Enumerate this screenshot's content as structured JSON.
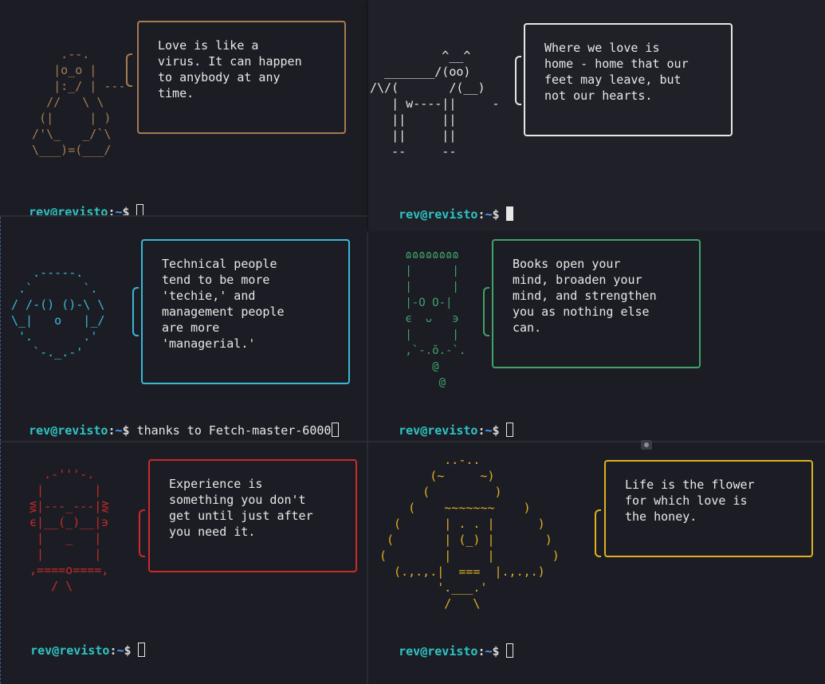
{
  "prompt": {
    "user_host": "rev@revisto",
    "colon": ":",
    "path": "~",
    "dollar": "$"
  },
  "colors": {
    "brown": "#a57c4f",
    "white": "#e6e6e6",
    "cyan": "#39b8d8",
    "green": "#3fa36a",
    "red": "#c92a2a",
    "yellow": "#e0b020"
  },
  "panes": [
    {
      "id": "top-left",
      "ascii": "      .--.\n     |o_o |\n     |:_/ | ---\n    //   \\ \\\n   (|     | )\n  /'\\_   _/`\\\n  \\___)=(___/",
      "quote": "Love is like a\nvirus. It can happen\nto anybody at any\ntime.",
      "command": ""
    },
    {
      "id": "top-right",
      "ascii": "          ^__^\n  _______/(oo)\n/\\/(       /(__)\n   | w----||     -\n   ||     ||\n   ||     ||\n   --     --",
      "quote": "Where we love is\nhome - home that our\nfeet may leave, but\nnot our hearts.",
      "command": ""
    },
    {
      "id": "mid-left",
      "ascii": "   .-----.\n .`       `.\n/ /-() ()-\\ \\\n\\_|   o   |_/\n '.       .'\n   `-._.-'",
      "quote": "Technical people\ntend to be more\n'techie,' and\nmanagement people\nare more\n'managerial.'",
      "command": "thanks to Fetch-master-6000"
    },
    {
      "id": "mid-right",
      "ascii": " ɷɷɷɷɷɷɷɷ\n |      |\n |      |\n |-O O-|\n ϵ  ᴗ   ϶\n |      |\n ,`-.ŏ.-`.\n     @\n      @",
      "quote": "Books open your\nmind, broaden your\nmind, and strengthen\nyou as nothing else\ncan.",
      "command": ""
    },
    {
      "id": "bot-left",
      "ascii": "   .-'''-.\n  |       |\n ⋚|---_---|⋛\n ϵ|__(_)__|϶\n  |   _   |\n  |       |\n ,====o====,\n    / \\",
      "quote": "Experience is\nsomething you don't\nget until just after\nyou need it.",
      "command": ""
    },
    {
      "id": "bot-right",
      "ascii": "         ..-..\n       (~     ~)\n      (         )\n    (    ~~~~~~~    )\n  (      | . . |      )\n (       | (_) |       )\n(        |     |        )\n  (.,.,.|  ===  |.,.,.)\n        '.___.'\n         /   \\",
      "quote": "Life is the flower\nfor which love is\nthe honey.",
      "command": ""
    }
  ]
}
